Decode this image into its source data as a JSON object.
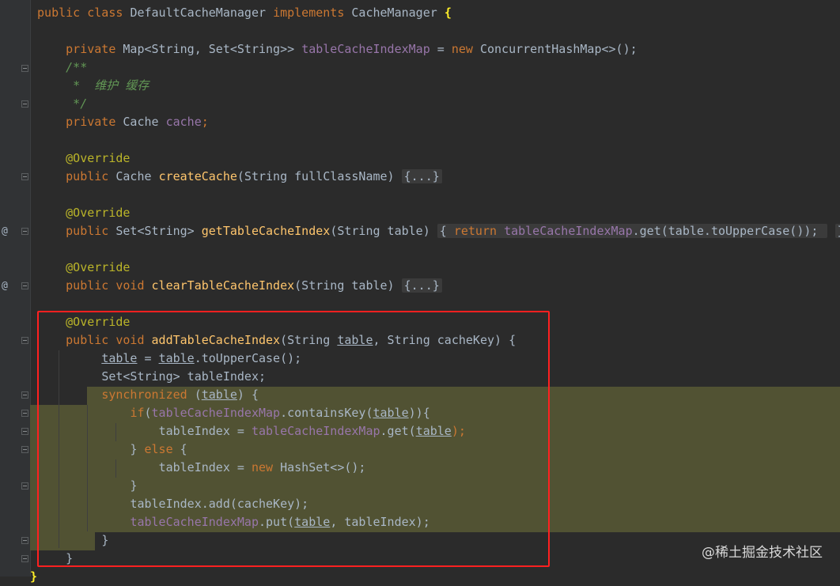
{
  "code": {
    "class_decl": {
      "kw1": "public class ",
      "name": "DefaultCacheManager ",
      "kw2": "implements ",
      "iface": "CacheManager ",
      "brace": "{"
    },
    "field1": {
      "mod": "private ",
      "type": "Map<String, Set<String>> ",
      "name": "tableCacheIndexMap",
      "eq": " = ",
      "kw_new": "new ",
      "rest": "ConcurrentHashMap<>();"
    },
    "comment": {
      "open": "/**",
      "body": " *  维护 缓存",
      "close": " */"
    },
    "field2": {
      "mod": "private ",
      "type": "Cache ",
      "name": "cache",
      "semi": ";"
    },
    "override": "@Override",
    "m1": {
      "mod": "public ",
      "type": "Cache ",
      "name": "createCache",
      "params": "(String fullClassName) ",
      "folded": "{...}"
    },
    "m2": {
      "mod": "public ",
      "type": "Set<String> ",
      "name": "getTableCacheIndex",
      "params": "(String table) ",
      "body_open": "{ ",
      "kw_return": "return ",
      "field": "tableCacheIndexMap",
      "rest": ".get(table.toUpperCase()); ",
      "body_close": "}"
    },
    "m3": {
      "mod": "public void ",
      "name": "clearTableCacheIndex",
      "params": "(String table) ",
      "folded": "{...}"
    },
    "m4": {
      "mod": "public void ",
      "name": "addTableCacheIndex",
      "p_open": "(String ",
      "p_table": "table",
      "p_rest": ", String cacheKey) {",
      "l1_a": "table",
      "l1_b": " = ",
      "l1_c": "table",
      "l1_d": ".toUpperCase();",
      "l2": "Set<String> tableIndex;",
      "l3_kw": "synchronized",
      "l3_a": " (",
      "l3_b": "table",
      "l3_c": ") {",
      "l4_kw": "if",
      "l4_a": "(",
      "l4_fld": "tableCacheIndexMap",
      "l4_b": ".containsKey(",
      "l4_c": "table",
      "l4_d": ")){",
      "l5_a": "tableIndex = ",
      "l5_fld": "tableCacheIndexMap",
      "l5_b": ".get(",
      "l5_c": "table",
      "l5_d": ");",
      "l6_a": "} ",
      "l6_kw": "else",
      "l6_b": " {",
      "l7_a": "tableIndex = ",
      "l7_kw": "new ",
      "l7_b": "HashSet<>();",
      "l8": "}",
      "l9": "tableIndex.add(cacheKey);",
      "l10_fld": "tableCacheIndexMap",
      "l10_a": ".put(",
      "l10_b": "table",
      "l10_c": ", tableIndex);",
      "l11": "}",
      "l12": "}"
    },
    "last_brace": "}"
  },
  "gutter": {
    "implements_marker": "@"
  },
  "watermark": "@稀土掘金技术社区",
  "colors": {
    "background": "#2b2b2b",
    "keyword": "#cc7832",
    "field": "#9876aa",
    "method": "#ffc66d",
    "annotation": "#bbb529",
    "comment": "#629755",
    "highlight_bg": "#515233",
    "box": "#ff2020"
  }
}
